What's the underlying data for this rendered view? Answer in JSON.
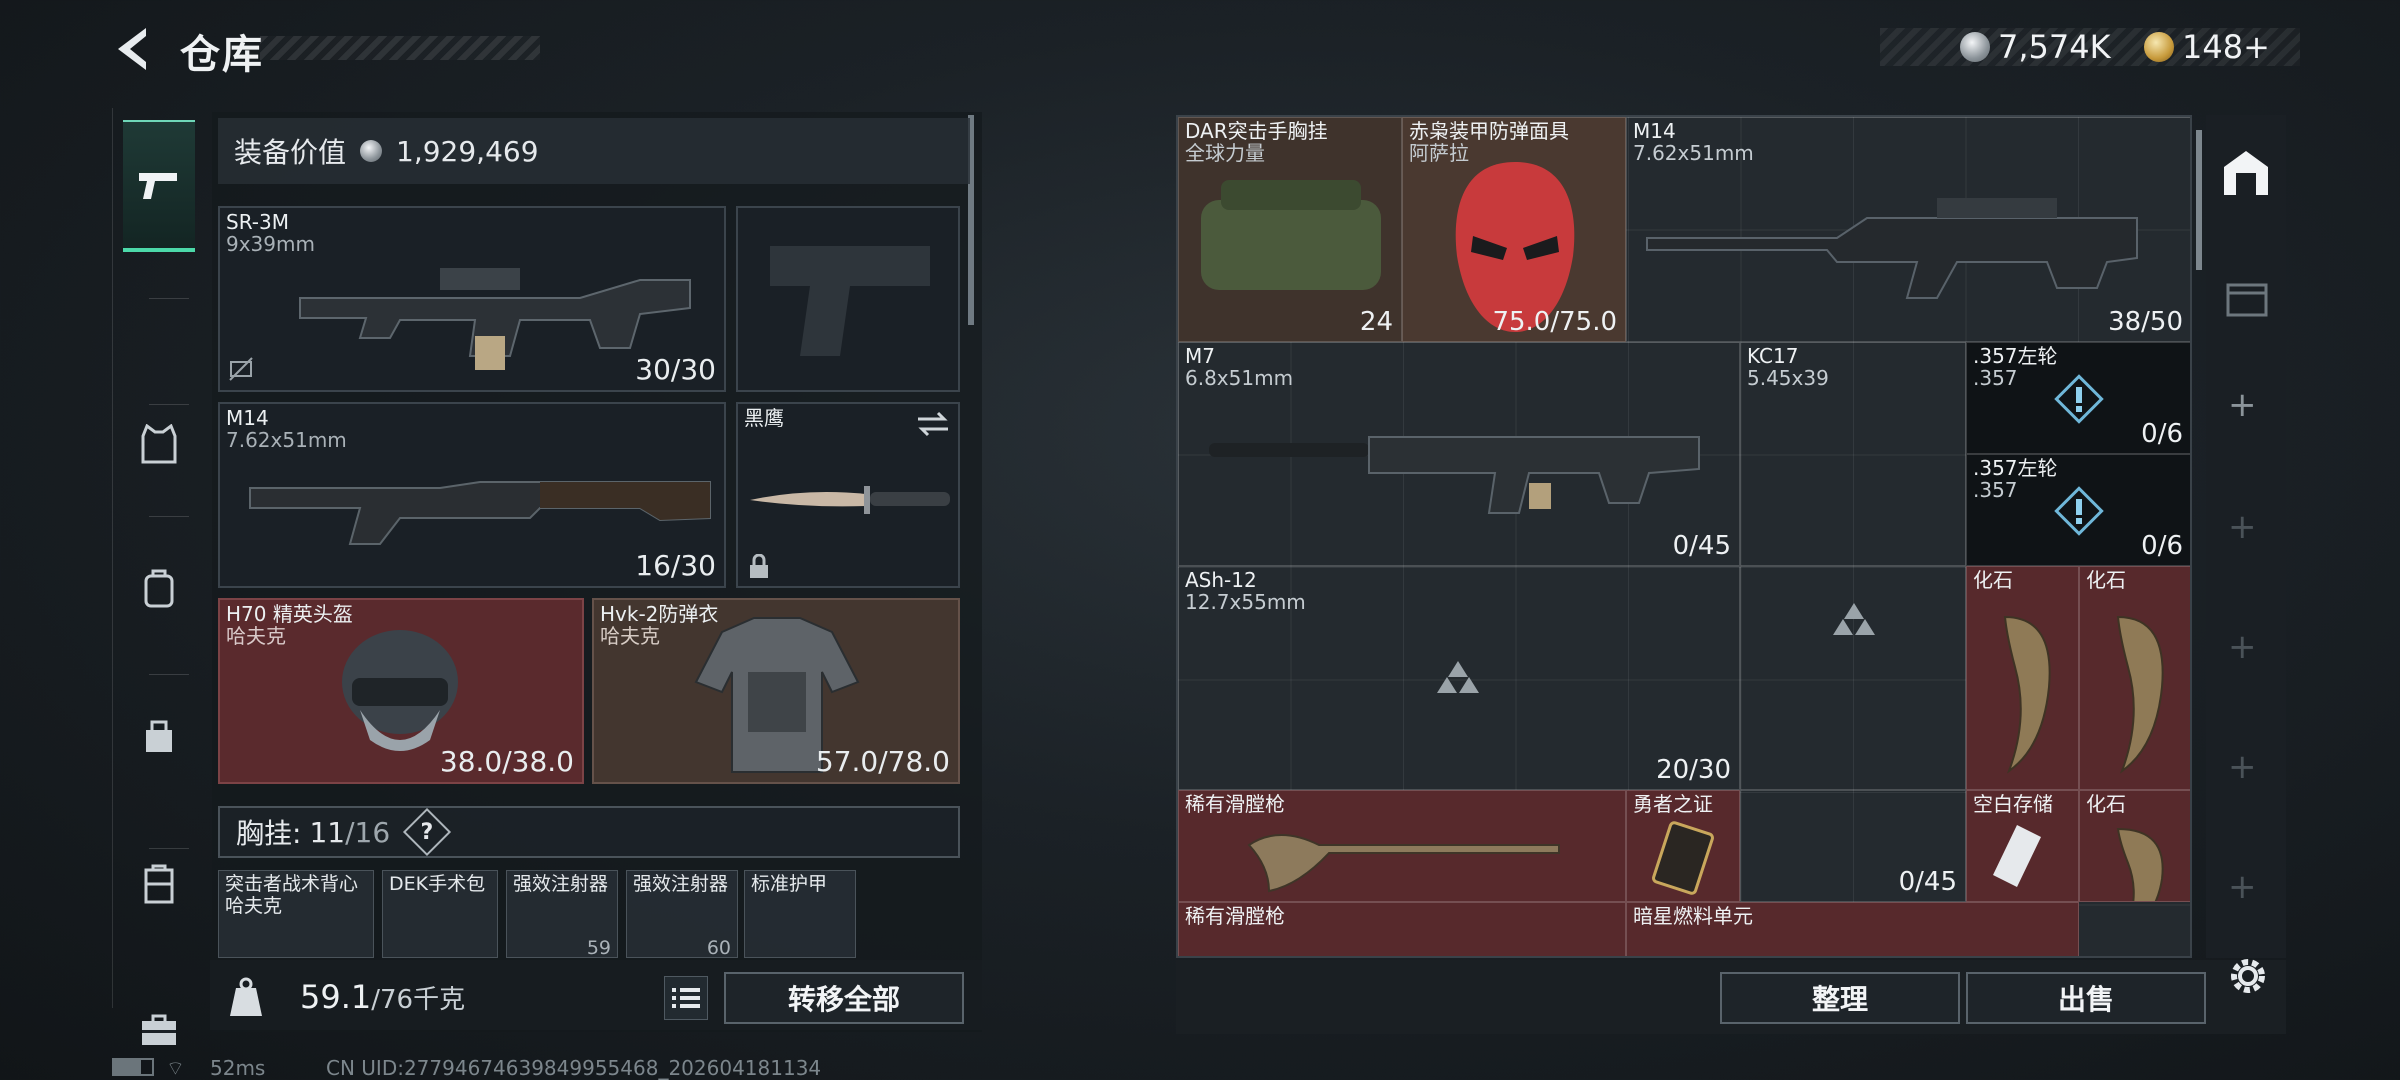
{
  "header": {
    "title": "仓库",
    "currency": [
      {
        "icon": "silver-coin-icon",
        "value": "7,574K"
      },
      {
        "icon": "gold-coin-icon",
        "value": "148+"
      }
    ]
  },
  "categories": [
    {
      "name": "firearms",
      "icon": "pistol-icon",
      "active": true
    },
    {
      "name": "armor",
      "icon": "vest-icon"
    },
    {
      "name": "backpack",
      "icon": "backpack-icon"
    },
    {
      "name": "bag",
      "icon": "bag-icon"
    },
    {
      "name": "container",
      "icon": "case-icon"
    },
    {
      "name": "toolbox",
      "icon": "toolbox-icon"
    }
  ],
  "equipment": {
    "value_label": "装备价值",
    "value": "1,929,469",
    "primary": {
      "name": "SR-3M",
      "caliber": "9x39mm",
      "ammo": "30/30"
    },
    "secondary": {
      "name": "M14",
      "caliber": "7.62x51mm",
      "ammo": "16/30"
    },
    "melee": {
      "name": "黑鹰"
    },
    "helmet": {
      "name": "H70 精英头盔",
      "brand": "哈夫克",
      "durability": "38.0/38.0"
    },
    "armor": {
      "name": "Hvk-2防弹衣",
      "brand": "哈夫克",
      "durability": "57.0/78.0"
    },
    "chest_label": "胸挂:",
    "chest_used": "11",
    "chest_total": "/16",
    "chest_help": "?",
    "chest_items": [
      {
        "name": "突击者战术背心",
        "sub": "哈夫克"
      },
      {
        "name": "DEK手术包",
        "sub": ""
      },
      {
        "name": "强效注射器",
        "sub": "59"
      },
      {
        "name": "强效注射器",
        "sub": "60"
      },
      {
        "name": "标准护甲",
        "sub": ""
      }
    ],
    "weight": "59.1",
    "weight_cap": "/76千克",
    "transfer_all": "转移全部"
  },
  "storage": {
    "items": [
      {
        "name": "DAR突击手胸挂",
        "sub": "全球力量",
        "value": "24"
      },
      {
        "name": "赤枭装甲防弹面具",
        "sub": "阿萨拉",
        "value": "75.0/75.0"
      },
      {
        "name": "M14",
        "sub": "7.62x51mm",
        "value": "38/50"
      },
      {
        "name": "M7",
        "sub": "6.8x51mm",
        "value": "0/45"
      },
      {
        "name": "KC17",
        "sub": "5.45x39",
        "value": ""
      },
      {
        "name": ".357左轮",
        "sub": ".357",
        "value": "0/6"
      },
      {
        "name": ".357左轮",
        "sub": ".357",
        "value": "0/6"
      },
      {
        "name": "ASh-12",
        "sub": "12.7x55mm",
        "value": "20/30"
      },
      {
        "name": "化石",
        "sub": "",
        "value": ""
      },
      {
        "name": "化石",
        "sub": "",
        "value": ""
      },
      {
        "name": "稀有滑膛枪",
        "sub": "",
        "value": ""
      },
      {
        "name": "勇者之证",
        "sub": "",
        "value": ""
      },
      {
        "name": "",
        "sub": "",
        "value": "0/45"
      },
      {
        "name": "空白存储",
        "sub": "",
        "value": ""
      },
      {
        "name": "化石",
        "sub": "",
        "value": ""
      },
      {
        "name": "稀有滑膛枪",
        "sub": "",
        "value": ""
      },
      {
        "name": "暗星燃料单元",
        "sub": "",
        "value": ""
      }
    ],
    "sort_label": "整理",
    "sell_label": "出售"
  },
  "status": {
    "ping": "52ms",
    "uid": "CN UID:27794674639849955468_202604181134"
  },
  "colors": {
    "accent": "#4cd9a9",
    "rare_red": "#57292c",
    "epic_brown": "#43362f"
  }
}
